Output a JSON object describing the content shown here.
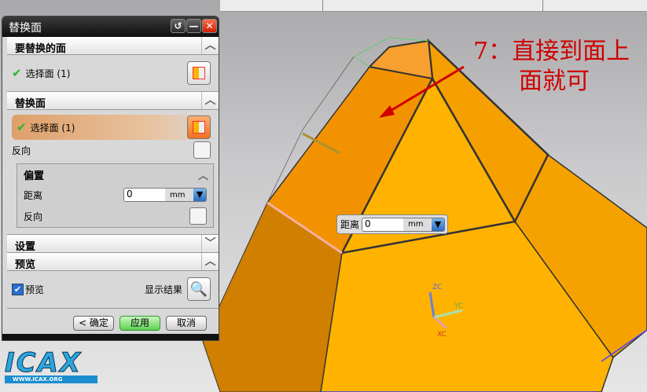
{
  "dialog": {
    "title": "替换面",
    "section_faces_to_replace": {
      "label": "要替换的面",
      "select_face": "选择面 (1)"
    },
    "section_replacement_face": {
      "label": "替换面",
      "select_face": "选择面 (1)",
      "reverse": "反向"
    },
    "section_offset": {
      "label": "偏置",
      "distance_label": "距离",
      "distance_value": "0",
      "unit": "mm",
      "reverse": "反向"
    },
    "section_settings": {
      "label": "设置"
    },
    "section_preview": {
      "label": "预览",
      "preview_checkbox": "预览",
      "preview_checked": true,
      "show_result": "显示结果"
    },
    "buttons": {
      "ok": "< 确定 >",
      "apply": "应用",
      "cancel": "取消"
    }
  },
  "viewport": {
    "annotation_line1": "7：直接到面上",
    "annotation_line2": "面就可",
    "float_distance": {
      "label": "距离",
      "value": "0",
      "unit": "mm"
    },
    "triad": {
      "z": "ZC",
      "y": "YC",
      "x": "XC"
    }
  },
  "logo": {
    "text": "ICAX",
    "url_text": "WWW.ICAX.ORG"
  }
}
